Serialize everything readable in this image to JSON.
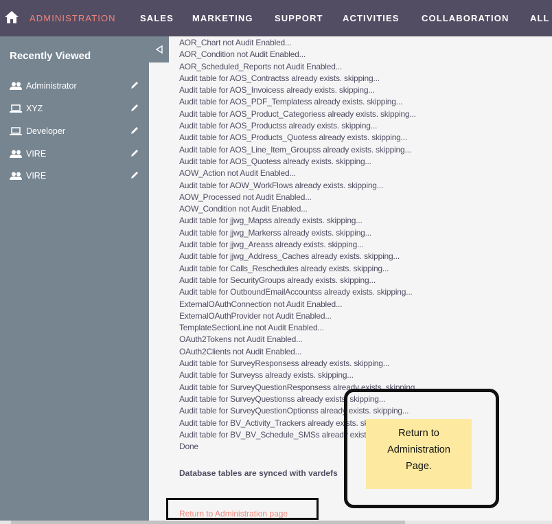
{
  "topnav": {
    "items": [
      "ADMINISTRATION",
      "SALES",
      "MARKETING",
      "SUPPORT",
      "ACTIVITIES",
      "COLLABORATION",
      "ALL"
    ]
  },
  "sidebar": {
    "title": "Recently Viewed",
    "items": [
      {
        "label": "Administrator",
        "icon": "users-icon"
      },
      {
        "label": "XYZ",
        "icon": "laptop-icon"
      },
      {
        "label": "Developer",
        "icon": "laptop-icon"
      },
      {
        "label": "VIRE",
        "icon": "users-icon"
      },
      {
        "label": "VIRE",
        "icon": "users-icon"
      }
    ]
  },
  "log": {
    "lines": [
      "AOR_Chart not Audit Enabled...",
      "AOR_Condition not Audit Enabled...",
      "AOR_Scheduled_Reports not Audit Enabled...",
      "Audit table for AOS_Contractss already exists. skipping...",
      "Audit table for AOS_Invoicess already exists. skipping...",
      "Audit table for AOS_PDF_Templatess already exists. skipping...",
      "Audit table for AOS_Product_Categoriess already exists. skipping...",
      "Audit table for AOS_Productss already exists. skipping...",
      "Audit table for AOS_Products_Quotess already exists. skipping...",
      "Audit table for AOS_Line_Item_Groupss already exists. skipping...",
      "Audit table for AOS_Quotess already exists. skipping...",
      "AOW_Action not Audit Enabled...",
      "Audit table for AOW_WorkFlows already exists. skipping...",
      "AOW_Processed not Audit Enabled...",
      "AOW_Condition not Audit Enabled...",
      "Audit table for jjwg_Mapss already exists. skipping...",
      "Audit table for jjwg_Markerss already exists. skipping...",
      "Audit table for jjwg_Areass already exists. skipping...",
      "Audit table for jjwg_Address_Caches already exists. skipping...",
      "Audit table for Calls_Reschedules already exists. skipping...",
      "Audit table for SecurityGroups already exists. skipping...",
      "Audit table for OutboundEmailAccountss already exists. skipping...",
      "ExternalOAuthConnection not Audit Enabled...",
      "ExternalOAuthProvider not Audit Enabled...",
      "TemplateSectionLine not Audit Enabled...",
      "OAuth2Tokens not Audit Enabled...",
      "OAuth2Clients not Audit Enabled...",
      "Audit table for SurveyResponsess already exists. skipping...",
      "Audit table for Surveyss already exists. skipping...",
      "Audit table for SurveyQuestionResponsess already exists. skipping...",
      "Audit table for SurveyQuestionss already exists. skipping...",
      "Audit table for SurveyQuestionOptionss already exists. skipping...",
      "Audit table for BV_Activity_Trackers already exists. skipping...",
      "Audit table for BV_BV_Schedule_SMSs already exists. skipping...",
      "Done"
    ],
    "synced_message": "Database tables are synced with vardefs",
    "return_link": "Return to Administration page"
  },
  "annotation": {
    "note_lines": [
      "Return to",
      "Administration",
      "Page."
    ]
  },
  "colors": {
    "nav_bg": "#534d64",
    "accent": "#f08377",
    "sidebar_bg": "#778591",
    "note_bg": "#fdeaa0"
  }
}
